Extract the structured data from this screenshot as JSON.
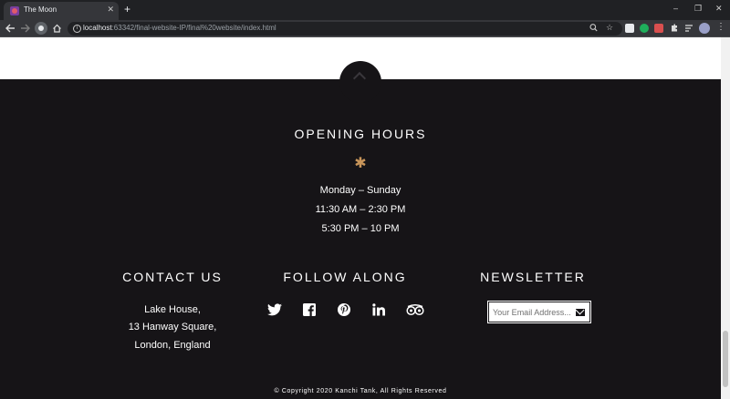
{
  "browser": {
    "tab_title": "The Moon",
    "close_glyph": "✕",
    "new_tab_glyph": "+",
    "url_host": "localhost",
    "url_path": ":63342/final-website-IP/final%20website/index.html",
    "window_controls": [
      "–",
      "❐",
      "✕"
    ],
    "toolbar_icons": [
      "back-icon",
      "forward-icon",
      "reload-icon",
      "home-icon",
      "zoom-icon",
      "bookmark-star-icon",
      "extensions-icon",
      "reading-list-icon",
      "menu-icon"
    ]
  },
  "footer": {
    "opening_hours": {
      "heading": "OPENING HOURS",
      "ornament": "✱",
      "lines": [
        "Monday – Sunday",
        "11:30 AM – 2:30 PM",
        "5:30 PM – 10 PM"
      ]
    },
    "contact": {
      "heading": "CONTACT US",
      "lines": [
        "Lake House,",
        "13 Hanway Square,",
        "London, England"
      ]
    },
    "follow": {
      "heading": "FOLLOW ALONG",
      "icons": [
        "twitter-icon",
        "facebook-icon",
        "pinterest-icon",
        "linkedin-icon",
        "tripadvisor-icon"
      ]
    },
    "newsletter": {
      "heading": "NEWSLETTER",
      "placeholder": "Your Email Address...",
      "icon": "envelope-icon"
    },
    "copyright": "© Copyright 2020 Kanchi Tank, All Rights Reserved"
  },
  "colors": {
    "footer_bg": "#161417",
    "accent_star": "#c8955a",
    "text": "#ffffff"
  }
}
